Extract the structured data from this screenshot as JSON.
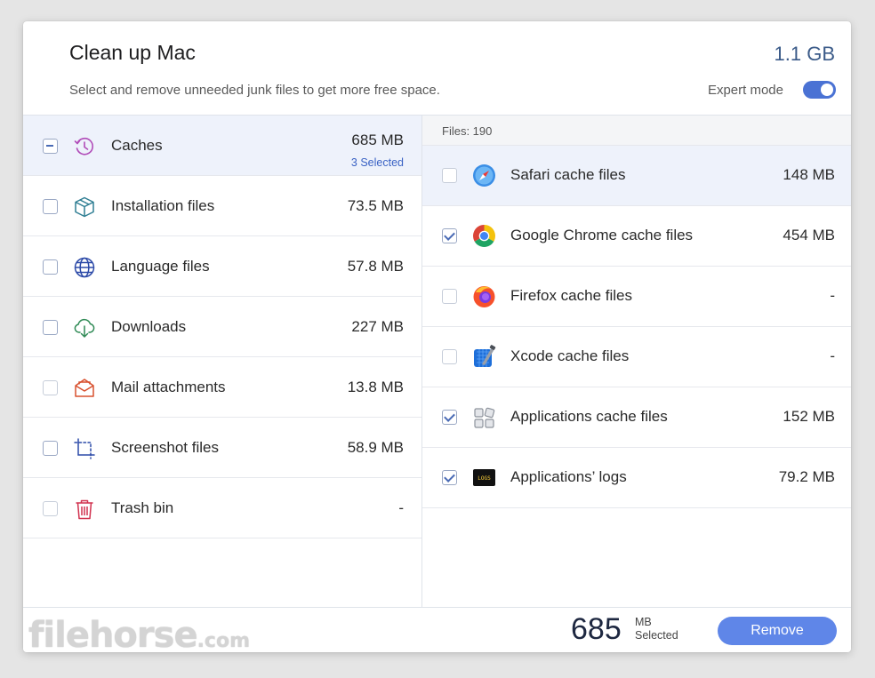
{
  "header": {
    "title": "Clean up Mac",
    "subtitle": "Select and remove unneeded junk files to get more free space.",
    "total_size": "1.1 GB",
    "expert_mode_label": "Expert mode",
    "expert_mode_on": true
  },
  "categories": [
    {
      "label": "Caches",
      "size": "685 MB",
      "sub": "3 Selected",
      "state": "mixed",
      "icon": "history-icon"
    },
    {
      "label": "Installation files",
      "size": "73.5 MB",
      "state": "unchecked",
      "icon": "package-icon"
    },
    {
      "label": "Language files",
      "size": "57.8 MB",
      "state": "unchecked",
      "icon": "globe-icon"
    },
    {
      "label": "Downloads",
      "size": "227 MB",
      "state": "unchecked",
      "icon": "cloud-download-icon"
    },
    {
      "label": "Mail attachments",
      "size": "13.8 MB",
      "state": "unchecked",
      "icon": "mail-icon"
    },
    {
      "label": "Screenshot files",
      "size": "58.9 MB",
      "state": "unchecked",
      "icon": "crop-icon"
    },
    {
      "label": "Trash bin",
      "size": "-",
      "state": "unchecked",
      "icon": "trash-icon"
    }
  ],
  "files": {
    "count_label": "Files: 190",
    "items": [
      {
        "label": "Safari cache files",
        "size": "148 MB",
        "checked": false,
        "icon": "safari-icon"
      },
      {
        "label": "Google Chrome cache files",
        "size": "454 MB",
        "checked": true,
        "icon": "chrome-icon"
      },
      {
        "label": "Firefox cache files",
        "size": "-",
        "checked": false,
        "icon": "firefox-icon"
      },
      {
        "label": "Xcode cache files",
        "size": "-",
        "checked": false,
        "icon": "xcode-icon"
      },
      {
        "label": "Applications cache files",
        "size": "152 MB",
        "checked": true,
        "icon": "applications-icon"
      },
      {
        "label": "Applications’ logs",
        "size": "79.2 MB",
        "checked": true,
        "icon": "logs-icon",
        "icon_text": "LOGS"
      }
    ]
  },
  "footer": {
    "watermark_main": "filehorse",
    "watermark_suffix": ".com",
    "selected_number": "685",
    "selected_unit": "MB",
    "selected_label": "Selected",
    "remove_label": "Remove"
  },
  "colors": {
    "accent": "#5f86e8",
    "toggle": "#4a72d4",
    "selected_row": "#eef2fb",
    "size_heading": "#3a5a88"
  }
}
